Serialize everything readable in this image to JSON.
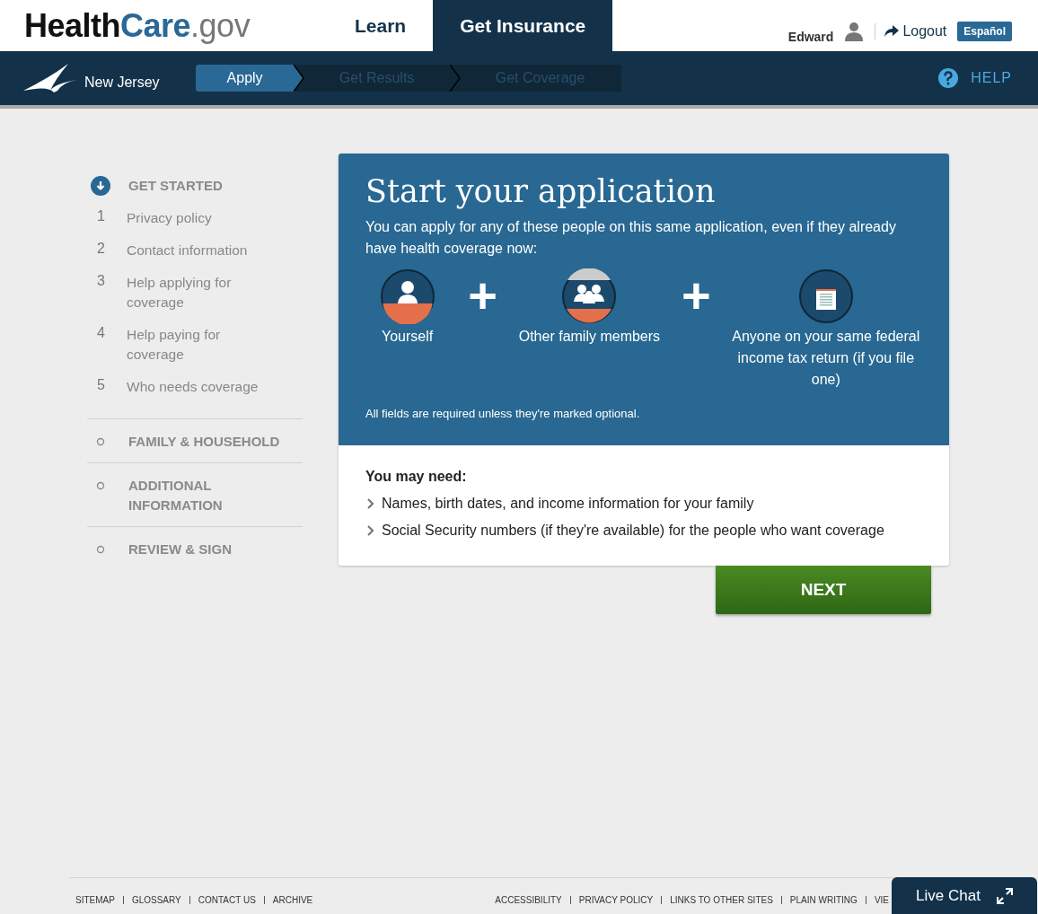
{
  "header": {
    "logo": [
      "Health",
      "Care",
      ".gov"
    ],
    "nav": [
      {
        "label": "Learn",
        "selected": false
      },
      {
        "label": "Get Insurance",
        "selected": true
      }
    ],
    "user": "Edward",
    "logout": "Logout",
    "language": "Español"
  },
  "subheader": {
    "state": "New Jersey",
    "steps": [
      {
        "label": "Apply",
        "selected": true
      },
      {
        "label": "Get Results",
        "selected": false
      },
      {
        "label": "Get Coverage",
        "selected": false
      }
    ],
    "help": "HELP"
  },
  "sidebar": {
    "sections": [
      {
        "label": "GET STARTED",
        "current": true,
        "children": [
          {
            "number": "1",
            "label": "Privacy policy"
          },
          {
            "number": "2",
            "label": "Contact information"
          },
          {
            "number": "3",
            "label": "Help applying for coverage"
          },
          {
            "number": "4",
            "label": "Help paying for coverage"
          },
          {
            "number": "5",
            "label": "Who needs coverage"
          }
        ]
      },
      {
        "label": "FAMILY & HOUSEHOLD",
        "current": false
      },
      {
        "label": "ADDITIONAL INFORMATION",
        "current": false
      },
      {
        "label": "REVIEW & SIGN",
        "current": false
      }
    ]
  },
  "card": {
    "title": "Start your application",
    "intro": "You can apply for any of these people on this same application, even if they already have health coverage now:",
    "people": [
      {
        "kind": "person",
        "label": "Yourself"
      },
      {
        "kind": "family",
        "label": "Other family members"
      },
      {
        "kind": "tax",
        "label": "Anyone on your same federal income tax return (if you file one)"
      }
    ],
    "plus": "+",
    "note": "All fields are required unless they're marked optional.",
    "needs_title": "You may need:",
    "needs": [
      "Names, birth dates, and income information for your family",
      "Social Security numbers (if they're available) for the people who want coverage"
    ]
  },
  "next_button": "NEXT",
  "footer": {
    "left": [
      "SITEMAP",
      "GLOSSARY",
      "CONTACT US",
      "ARCHIVE"
    ],
    "right": [
      "ACCESSIBILITY",
      "PRIVACY POLICY",
      "LINKS TO OTHER SITES",
      "PLAIN WRITING",
      "VIE"
    ]
  },
  "live_chat": "Live Chat"
}
